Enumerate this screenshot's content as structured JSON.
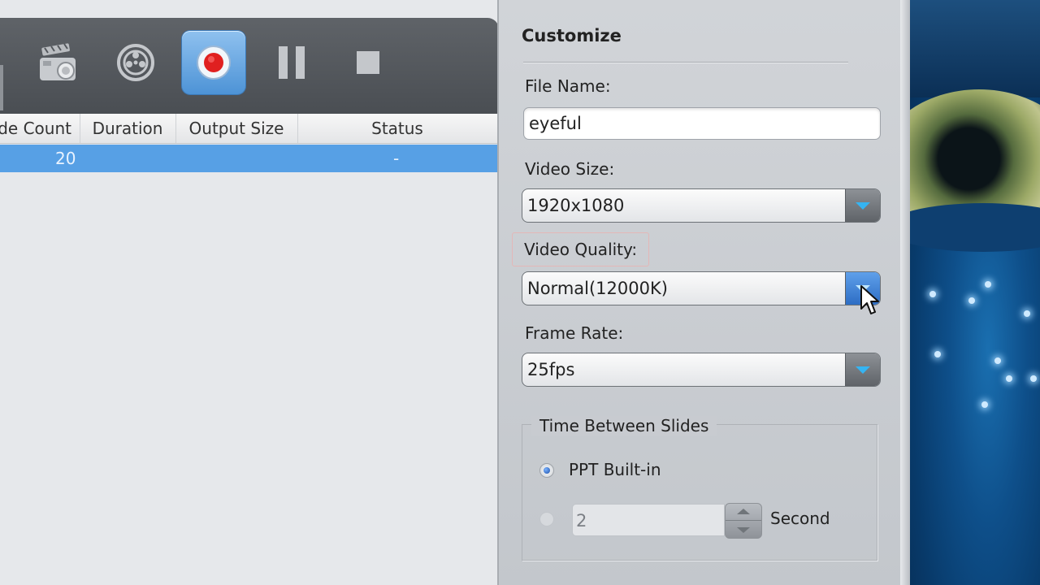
{
  "toolbar": {
    "buttons": [
      {
        "icon": "clapperboard-camera-icon"
      },
      {
        "icon": "film-reel-icon"
      },
      {
        "icon": "record-icon",
        "active": true
      },
      {
        "icon": "pause-icon"
      },
      {
        "icon": "stop-icon"
      }
    ]
  },
  "table": {
    "headers": [
      "de Count",
      "Duration",
      "Output Size",
      "Status"
    ],
    "rows": [
      {
        "slide_count": "20",
        "duration": "",
        "output_size": "",
        "status": "-"
      }
    ],
    "selected_row_color": "#57a0e5"
  },
  "customize": {
    "title": "Customize",
    "file_name_label": "File Name:",
    "file_name_value": "eyeful",
    "video_size_label": "Video Size:",
    "video_size_value": "1920x1080",
    "video_quality_label": "Video Quality:",
    "video_quality_value": "Normal(12000K)",
    "frame_rate_label": "Frame Rate:",
    "frame_rate_value": "25fps",
    "time_between_slides": {
      "title": "Time Between Slides",
      "option_builtin": "PPT Built-in",
      "option_builtin_selected": true,
      "seconds_value": "2",
      "seconds_unit": "Second"
    }
  },
  "colors": {
    "toolbar_bg": "#54585d",
    "record_accent": "#e02020",
    "dropdown_arrow": "#35b4f2"
  }
}
